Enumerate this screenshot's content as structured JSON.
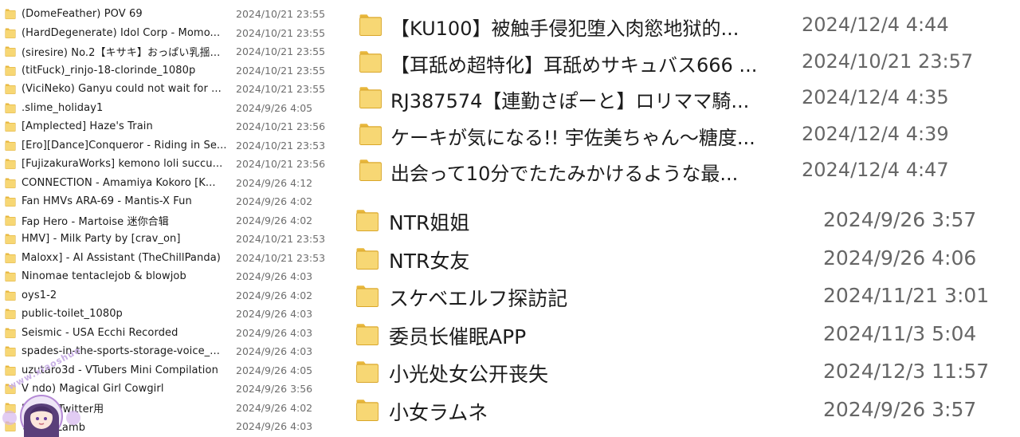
{
  "colors": {
    "folder_body": "#f7d774",
    "folder_tab": "#e8b73c",
    "folder_edge": "#d9a62a",
    "name_text": "#1a1a1a",
    "date_text": "#6d6d6d"
  },
  "left_list": [
    {
      "icon": "folder-icon",
      "name": "(DomeFeather) POV 69",
      "date": "2024/10/21 23:55"
    },
    {
      "icon": "folder-icon",
      "name": "(HardDegenerate) Idol Corp - Momo...",
      "date": "2024/10/21 23:55"
    },
    {
      "icon": "folder-icon",
      "name": "(siresire) No.2【キサキ】おっぱい乳揺...",
      "date": "2024/10/21 23:55"
    },
    {
      "icon": "folder-icon",
      "name": "(titFuck)_rinjo-18-clorinde_1080p",
      "date": "2024/10/21 23:55"
    },
    {
      "icon": "folder-icon",
      "name": "(ViciNeko) Ganyu could not wait for ...",
      "date": "2024/10/21 23:55"
    },
    {
      "icon": "folder-icon",
      "name": ".slime_holiday1",
      "date": "2024/9/26 4:05"
    },
    {
      "icon": "folder-icon",
      "name": "[Amplected] Haze's Train",
      "date": "2024/10/21 23:56"
    },
    {
      "icon": "folder-icon",
      "name": "[Ero][Dance]Conqueror - Riding in Se...",
      "date": "2024/10/21 23:53"
    },
    {
      "icon": "folder-icon",
      "name": "[FujizakuraWorks] kemono loli succu...",
      "date": "2024/10/21 23:56"
    },
    {
      "icon": "folder-icon",
      "name": "CONNECTION - Amamiya Kokoro [K...",
      "date": "2024/9/26 4:12"
    },
    {
      "icon": "folder-icon",
      "name": "Fan HMVs ARA-69 - Mantis-X Fun",
      "date": "2024/9/26 4:02"
    },
    {
      "icon": "folder-icon",
      "name": "Fap Hero - Martoise 迷你合辑",
      "date": "2024/9/26 4:02"
    },
    {
      "icon": "folder-icon",
      "name": "HMV] - Milk Party by [crav_on]",
      "date": "2024/10/21 23:53"
    },
    {
      "icon": "folder-icon",
      "name": "Maloxx] - AI Assistant (TheChillPanda)",
      "date": "2024/10/21 23:53"
    },
    {
      "icon": "folder-icon",
      "name": "Ninomae tentaclejob & blowjob",
      "date": "2024/9/26 4:03"
    },
    {
      "icon": "folder-icon",
      "name": "oys1-2",
      "date": "2024/9/26 4:02"
    },
    {
      "icon": "folder-icon",
      "name": "public-toilet_1080p",
      "date": "2024/9/26 4:03"
    },
    {
      "icon": "folder-icon",
      "name": "Seismic - USA Ecchi Recorded",
      "date": "2024/9/26 4:03"
    },
    {
      "icon": "folder-icon",
      "name": "spades-in-the-sports-storage-voice_...",
      "date": "2024/9/26 4:03"
    },
    {
      "icon": "folder-icon",
      "name": "uzutaro3d - VTubers Mini Compilation",
      "date": "2024/9/26 4:05"
    },
    {
      "icon": "folder-icon",
      "name": "V ndo) Magical Girl Cowgirl",
      "date": "2024/9/26 3:56"
    },
    {
      "icon": "folder-icon",
      "name": "図書館_Twitter用",
      "date": "2024/9/26 4:02"
    },
    {
      "icon": "folder-icon",
      "name": "ミ 達のLamb",
      "date": "2024/9/26 4:03"
    }
  ],
  "right_top_list": [
    {
      "icon": "folder-icon",
      "name": "【KU100】被触手侵犯堕入肉慾地狱的...",
      "date": "2024/12/4 4:44"
    },
    {
      "icon": "folder-icon",
      "name": "【耳舐め超特化】耳舐めサキュバス666 ...",
      "date": "2024/10/21 23:57"
    },
    {
      "icon": "folder-icon",
      "name": "RJ387574【連勤さぽーと】ロリママ騎...",
      "date": "2024/12/4 4:35"
    },
    {
      "icon": "folder-icon",
      "name": "ケーキが気になる!! 宇佐美ちゃん～糖度...",
      "date": "2024/12/4 4:39"
    },
    {
      "icon": "folder-icon",
      "name": "出会って10分でたたみかけるような最...",
      "date": "2024/12/4 4:47"
    }
  ],
  "right_bottom_list": [
    {
      "icon": "folder-icon",
      "name": "NTR姐姐",
      "date": "2024/9/26 3:57"
    },
    {
      "icon": "folder-icon",
      "name": "NTR女友",
      "date": "2024/9/26 4:06"
    },
    {
      "icon": "folder-icon",
      "name": "スケベエルフ探訪記",
      "date": "2024/11/21 3:01"
    },
    {
      "icon": "folder-icon",
      "name": "委员长催眠APP",
      "date": "2024/11/3 5:04"
    },
    {
      "icon": "folder-icon",
      "name": "小光处女公开丧失",
      "date": "2024/12/3 11:57"
    },
    {
      "icon": "folder-icon",
      "name": "小女ラムネ",
      "date": "2024/9/26 3:57"
    }
  ],
  "watermark": {
    "text": "www.xiaoshuo"
  }
}
